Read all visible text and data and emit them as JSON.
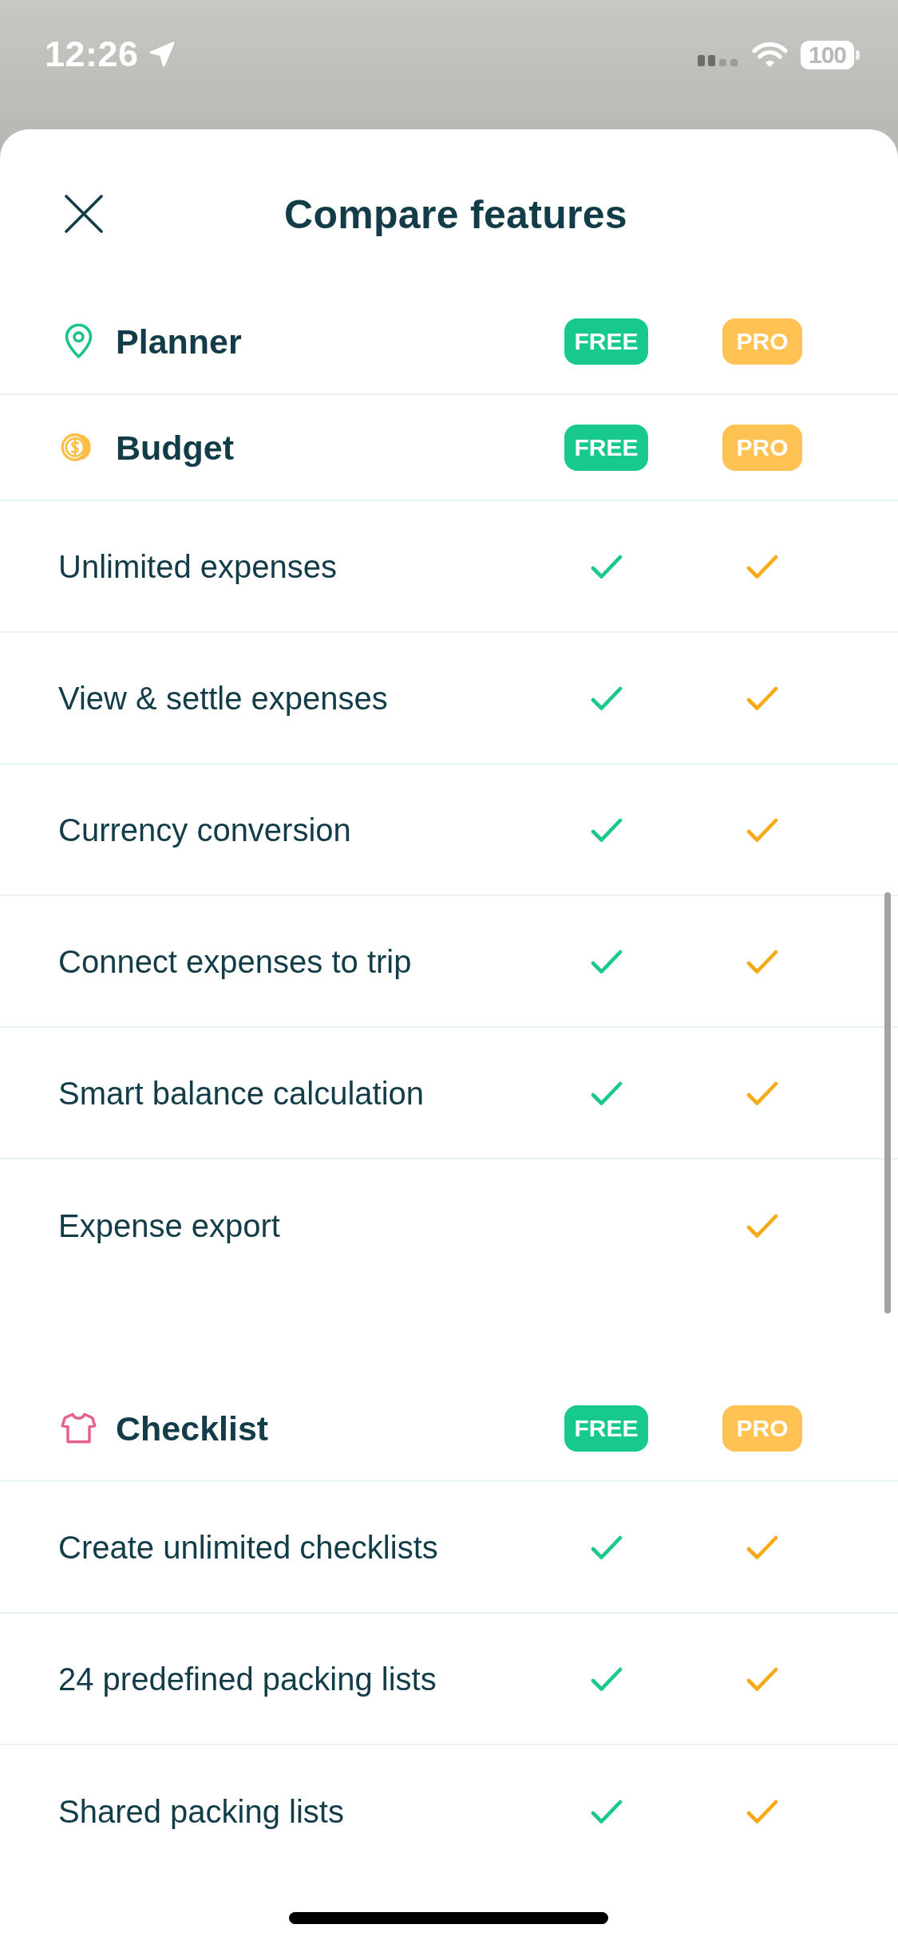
{
  "status_bar": {
    "time": "12:26",
    "battery": "100"
  },
  "sheet": {
    "title": "Compare features"
  },
  "sections": [
    {
      "title": "Planner",
      "badges": [
        {
          "label": "FREE",
          "kind": "free"
        },
        {
          "label": "PRO",
          "kind": "pro"
        }
      ]
    },
    {
      "title": "Budget",
      "badges": [
        {
          "label": "FREE",
          "kind": "free"
        },
        {
          "label": "PRO",
          "kind": "pro"
        }
      ],
      "features": [
        {
          "label": "Unlimited expenses",
          "free": true,
          "pro": true
        },
        {
          "label": "View & settle expenses",
          "free": true,
          "pro": true
        },
        {
          "label": "Currency conversion",
          "free": true,
          "pro": true
        },
        {
          "label": "Connect expenses to trip",
          "free": true,
          "pro": true
        },
        {
          "label": "Smart balance calculation",
          "free": true,
          "pro": true
        },
        {
          "label": "Expense export",
          "free": false,
          "pro": true
        }
      ]
    },
    {
      "title": "Checklist",
      "badges": [
        {
          "label": "FREE",
          "kind": "free"
        },
        {
          "label": "PRO",
          "kind": "pro"
        }
      ],
      "features": [
        {
          "label": "Create unlimited checklists",
          "free": true,
          "pro": true
        },
        {
          "label": "24 predefined packing lists",
          "free": true,
          "pro": true
        },
        {
          "label": "Shared packing lists",
          "free": true,
          "pro": true
        }
      ]
    }
  ]
}
